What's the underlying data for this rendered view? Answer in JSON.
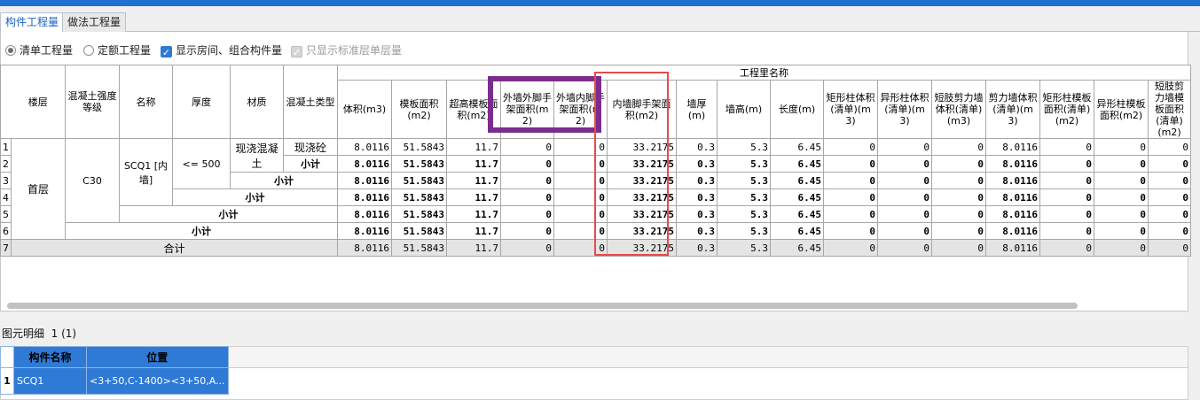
{
  "tabs": [
    "构件工程量",
    "做法工程量"
  ],
  "options": {
    "radio_list": "清单工程量",
    "radio_quota": "定额工程量",
    "check_room": "显示房间、组合构件量",
    "check_std": "只显示标准层单层量"
  },
  "headers": {
    "group": "工程里名称",
    "floor": "楼层",
    "strength": "混凝土强度等级",
    "name": "名称",
    "thickness": "厚度",
    "material": "材质",
    "ctype": "混凝土类型",
    "cols": [
      "体积(m3)",
      "模板面积(m2)",
      "超高模板面积(m2)",
      "外墙外脚手架面积(m2)",
      "外墙内脚手架面积(m2)",
      "内墙脚手架面积(m2)",
      "墙厚(m)",
      "墙高(m)",
      "长度(m)",
      "矩形柱体积(清单)(m3)",
      "异形柱体积(清单)(m3)",
      "短肢剪力墙体积(清单)(m3)",
      "剪力墙体积(清单)(m3)",
      "矩形柱模板面积(清单)(m2)",
      "异形柱模板面积(m2)",
      "短肢剪力墙模板面积(清单)(m2)"
    ]
  },
  "rows": {
    "floor": "首层",
    "strength": "C30",
    "name": "SCQ1 [内墙]",
    "thickness": "<= 500",
    "material": "现浇混凝土",
    "ctype": "现浇砼",
    "subtotal": "小计",
    "total": "合计",
    "numbers": [
      "1",
      "2",
      "3",
      "4",
      "5",
      "6",
      "7"
    ],
    "values": [
      "8.0116",
      "51.5843",
      "11.7",
      "0",
      "0",
      "33.2175",
      "0.3",
      "5.3",
      "6.45",
      "0",
      "0",
      "0",
      "8.0116",
      "0",
      "0",
      "0"
    ]
  },
  "detail": {
    "title": "图元明细",
    "count": "1 (1)",
    "col_name": "构件名称",
    "col_pos": "位置",
    "row_no": "1",
    "row_name": "SCQ1",
    "row_pos": "<3+50,C-1400><3+50,A..."
  }
}
